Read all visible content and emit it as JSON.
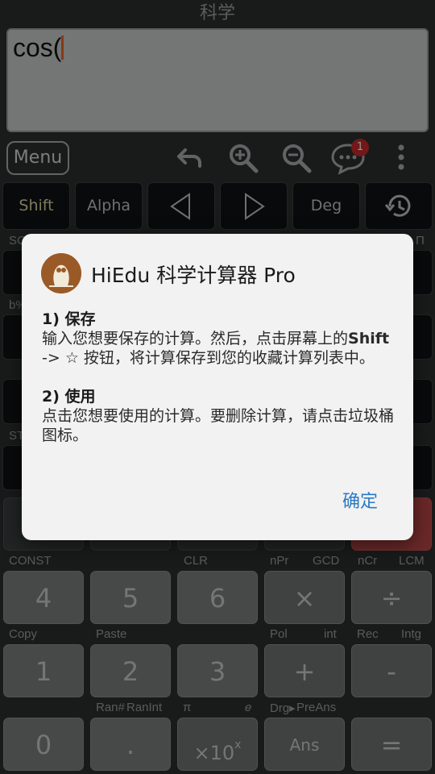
{
  "title": "科学",
  "display": {
    "expression": "cos("
  },
  "toolbar": {
    "menu_label": "Menu",
    "notification_count": "1"
  },
  "function_row": {
    "shift": "Shift",
    "alpha": "Alpha",
    "deg": "Deg"
  },
  "hints": {
    "row_a_left": "SC",
    "row_a_right": "Π",
    "row_b_left": "b%",
    "row_c_left": "ST",
    "row_const": [
      "CONST",
      "CLR",
      "nPr",
      "GCD",
      "nCr",
      "LCM"
    ],
    "row_copy": [
      "Copy",
      "Paste",
      "Pol",
      "int",
      "Rec",
      "Intg"
    ],
    "row_ran": [
      "Ran#",
      "RanInt",
      "π",
      "𝑒",
      "Drg▸",
      "PreAns"
    ]
  },
  "keys": {
    "row1": [
      "4",
      "5",
      "6",
      "×",
      "÷"
    ],
    "row2": [
      "1",
      "2",
      "3",
      "+",
      "-"
    ],
    "row3": [
      "0",
      ".",
      "×10",
      "Ans",
      "="
    ],
    "exp_sup": "x"
  },
  "dialog": {
    "title": "HiEdu 科学计算器 Pro",
    "section1_heading": "1) 保存",
    "section1_line1": "输入您想要保存的计算。然后，点击屏幕上的",
    "section1_shift": "Shift",
    "section1_line2": " -> ☆ 按钮，将计算保存到您的收藏计算列表中。",
    "section2_heading": "2) 使用",
    "section2_text": "点击您想要使用的计算。要删除计算，请点击垃圾桶图标。",
    "ok_label": "确定"
  }
}
